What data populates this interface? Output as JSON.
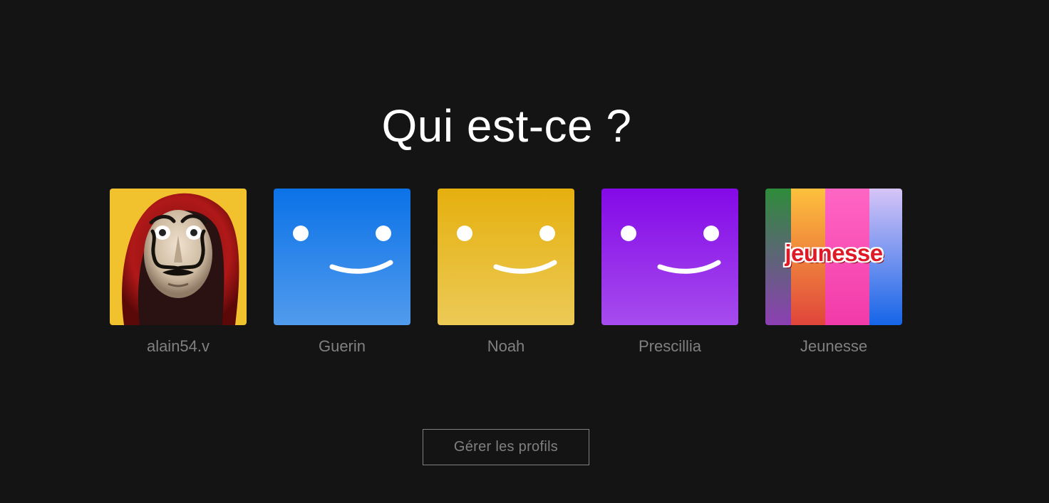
{
  "page": {
    "title": "Qui est-ce ?"
  },
  "profiles": [
    {
      "name": "alain54.v",
      "avatar": "mask-hood-icon",
      "color": "#f5c518"
    },
    {
      "name": "Guerin",
      "avatar": "smiley-blue-icon",
      "color": "#0b74e5"
    },
    {
      "name": "Noah",
      "avatar": "smiley-yellow-icon",
      "color": "#e6b00e"
    },
    {
      "name": "Prescillia",
      "avatar": "smiley-purple-icon",
      "color": "#8509e8"
    },
    {
      "name": "Jeunesse",
      "avatar": "kids-stripes-icon",
      "logo_text": "jeunesse"
    }
  ],
  "manage": {
    "label": "Gérer les profils"
  },
  "colors": {
    "background": "#141414",
    "text_muted": "#808080",
    "title": "#ffffff"
  }
}
